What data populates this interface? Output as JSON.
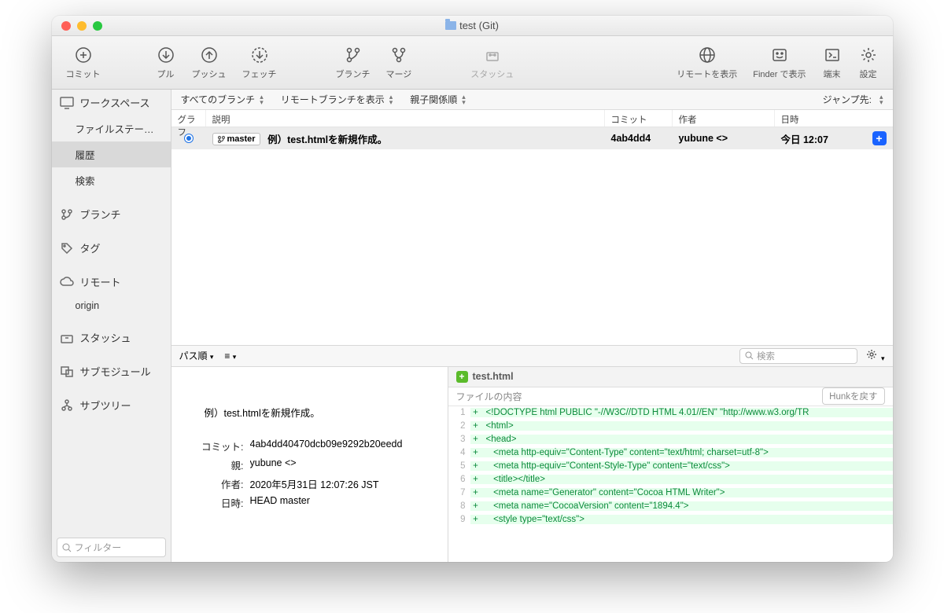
{
  "title": "test (Git)",
  "toolbar": {
    "commit": "コミット",
    "pull": "プル",
    "push": "プッシュ",
    "fetch": "フェッチ",
    "branch": "ブランチ",
    "merge": "マージ",
    "stash": "スタッシュ",
    "show_remote": "リモートを表示",
    "show_finder": "Finder で表示",
    "terminal": "端末",
    "settings": "設定"
  },
  "sidebar": {
    "workspace": "ワークスペース",
    "file_status": "ファイルステー…",
    "history": "履歴",
    "search": "検索",
    "branch": "ブランチ",
    "tag": "タグ",
    "remote": "リモート",
    "origin": "origin",
    "stash": "スタッシュ",
    "submodule": "サブモジュール",
    "subtree": "サブツリー",
    "filter_placeholder": "フィルター"
  },
  "filterbar": {
    "all_branches": "すべてのブランチ",
    "show_remote": "リモートブランチを表示",
    "ancestry": "親子関係順",
    "jump_to": "ジャンプ先:"
  },
  "columns": {
    "graph": "グラフ",
    "desc": "説明",
    "commit": "コミット",
    "author": "作者",
    "date": "日時"
  },
  "row": {
    "branch": "master",
    "message": "例）test.htmlを新規作成。",
    "hash": "4ab4dd4",
    "author": "yubune <>",
    "date": "今日 12:07"
  },
  "pathbar": {
    "path_order": "パス順",
    "list_icon": "≡",
    "search_placeholder": "検索"
  },
  "detail": {
    "message": "例）test.htmlを新規作成。",
    "commit_label": "コミット:",
    "commit_value": "4ab4dd40470dcb09e9292b20eedd",
    "parent_label": "親:",
    "parent_value": "yubune <>",
    "author_label": "作者:",
    "author_value": "2020年5月31日 12:07:26 JST",
    "date_label": "日時:",
    "date_value": "HEAD master"
  },
  "diff": {
    "filename": "test.html",
    "sub_label": "ファイルの内容",
    "hunk_revert": "Hunkを戻す",
    "lines": [
      "<!DOCTYPE html PUBLIC \"-//W3C//DTD HTML 4.01//EN\" \"http://www.w3.org/TR",
      "<html>",
      "<head>",
      "   <meta http-equiv=\"Content-Type\" content=\"text/html; charset=utf-8\">",
      "   <meta http-equiv=\"Content-Style-Type\" content=\"text/css\">",
      "   <title></title>",
      "   <meta name=\"Generator\" content=\"Cocoa HTML Writer\">",
      "   <meta name=\"CocoaVersion\" content=\"1894.4\">",
      "   <style type=\"text/css\">"
    ]
  }
}
